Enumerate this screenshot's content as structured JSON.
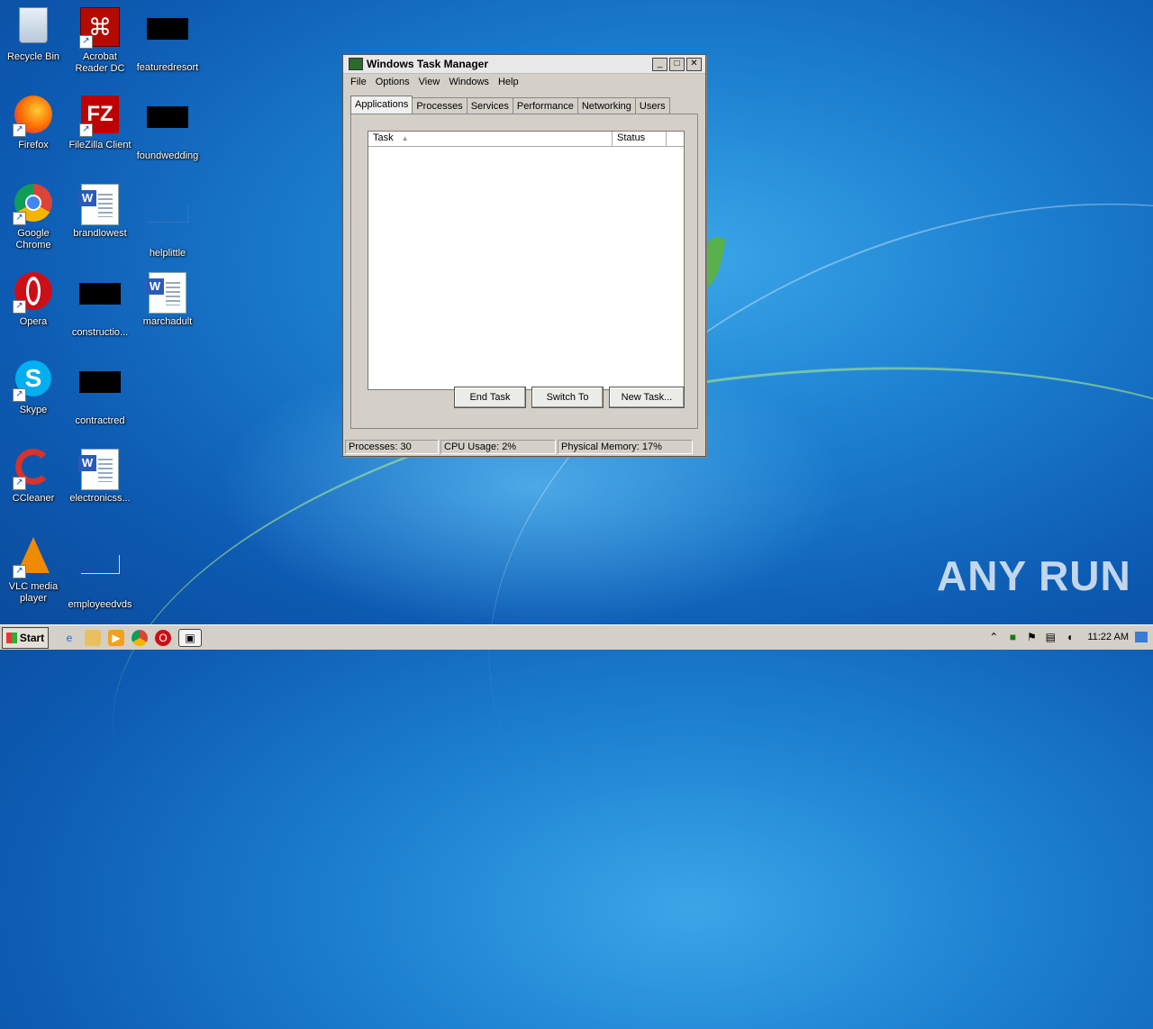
{
  "desktop": {
    "icons": [
      {
        "label": "Recycle Bin"
      },
      {
        "label": "Acrobat Reader DC"
      },
      {
        "label": "featuredresort"
      },
      {
        "label": "Firefox"
      },
      {
        "label": "FileZilla Client"
      },
      {
        "label": "foundwedding"
      },
      {
        "label": "Google Chrome"
      },
      {
        "label": "brandlowest"
      },
      {
        "label": "helplittle"
      },
      {
        "label": "Opera"
      },
      {
        "label": "constructio..."
      },
      {
        "label": "marchadult"
      },
      {
        "label": "Skype"
      },
      {
        "label": "contractred"
      },
      {
        "label": "CCleaner"
      },
      {
        "label": "electronicss..."
      },
      {
        "label": "VLC media player"
      },
      {
        "label": "employeedvds"
      }
    ],
    "watermark": "ANY RUN"
  },
  "window": {
    "title": "Windows Task Manager",
    "controls": {
      "minimize": "_",
      "maximize": "□",
      "close": "✕"
    },
    "menu": [
      "File",
      "Options",
      "View",
      "Windows",
      "Help"
    ],
    "tabs": [
      "Applications",
      "Processes",
      "Services",
      "Performance",
      "Networking",
      "Users"
    ],
    "active_tab": "Applications",
    "list": {
      "columns": [
        "Task",
        "Status"
      ],
      "rows": []
    },
    "buttons": {
      "end_task": "End Task",
      "switch_to": "Switch To",
      "new_task": "New Task..."
    },
    "status": {
      "processes": "Processes: 30",
      "cpu": "CPU Usage: 2%",
      "memory": "Physical Memory: 17%"
    }
  },
  "taskbar": {
    "start_label": "Start",
    "clock": "11:22 AM"
  }
}
